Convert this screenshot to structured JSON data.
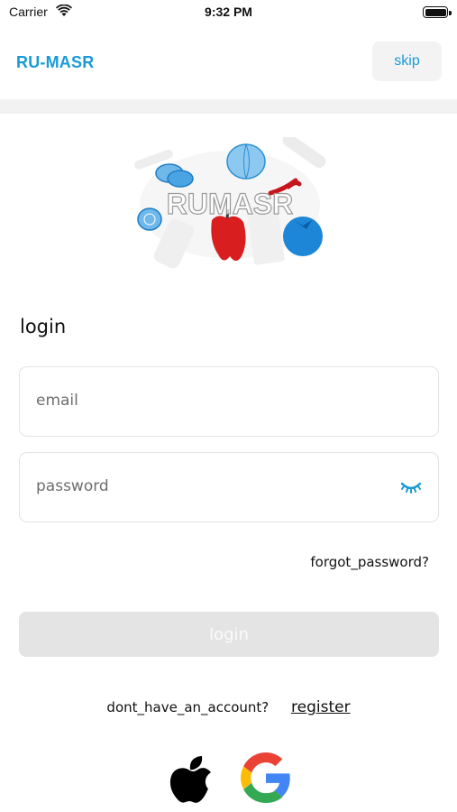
{
  "status_bar": {
    "carrier": "Carrier",
    "time": "9:32 PM"
  },
  "header": {
    "brand": "RU-MASR",
    "skip_label": "skip"
  },
  "logo": {
    "text": "RUMASR"
  },
  "login_form": {
    "title": "login",
    "email_placeholder": "email",
    "password_placeholder": "password",
    "forgot_password": "forgot_password?",
    "login_button": "login"
  },
  "register": {
    "question": "dont_have_an_account?",
    "link": "register"
  },
  "social": {
    "apple": "apple-icon",
    "google": "google-icon"
  },
  "colors": {
    "accent": "#1a9ad6",
    "button_disabled": "#e4e4e4",
    "field_border": "#e3e3e3"
  }
}
